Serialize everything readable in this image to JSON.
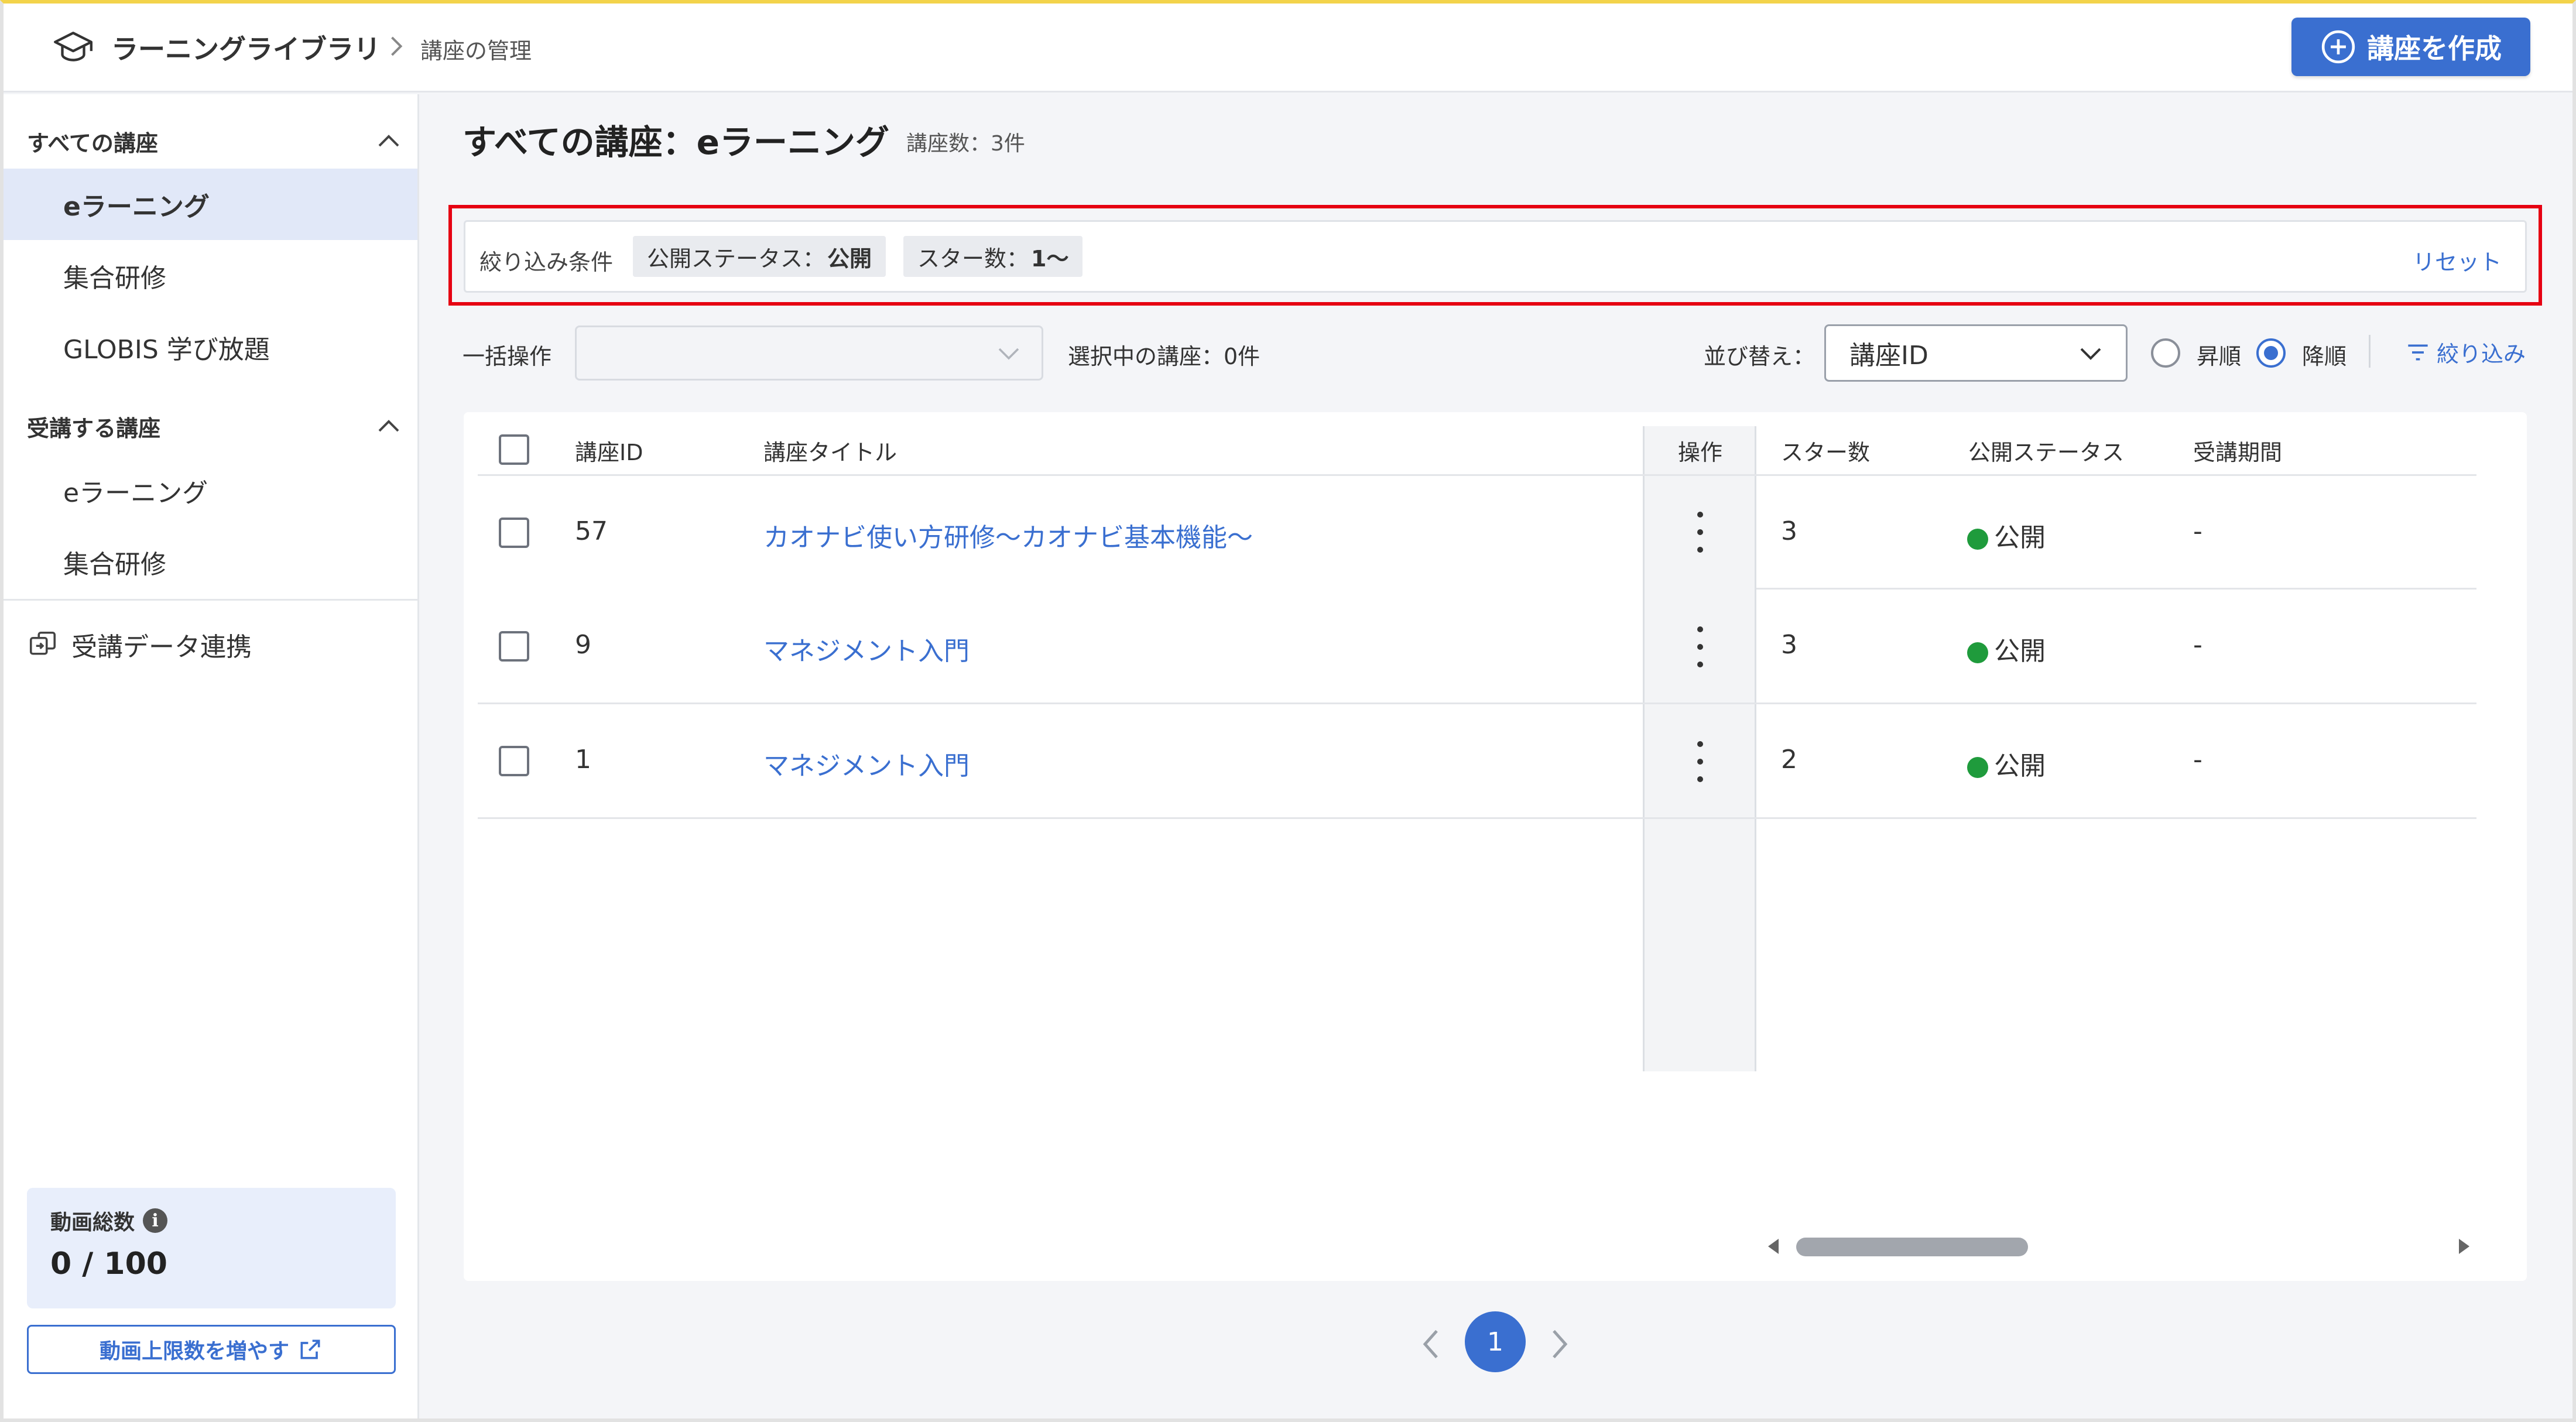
{
  "header": {
    "app_title": "ラーニングライブラリ",
    "breadcrumb": "講座の管理",
    "create_button": "講座を作成"
  },
  "sidebar": {
    "all_courses_heading": "すべての講座",
    "all_items": [
      {
        "label": "eラーニング",
        "active": true
      },
      {
        "label": "集合研修",
        "active": false
      },
      {
        "label": "GLOBIS 学び放題",
        "active": false
      }
    ],
    "enrolled_heading": "受講する講座",
    "enrolled_items": [
      {
        "label": "eラーニング"
      },
      {
        "label": "集合研修"
      }
    ],
    "sync_label": "受講データ連携",
    "quota_label": "動画総数",
    "quota_value": "0 / 100",
    "increase_button": "動画上限数を増やす"
  },
  "main": {
    "title": "すべての講座：eラーニング",
    "count": "講座数：3件",
    "filter": {
      "label": "絞り込み条件",
      "chips": [
        {
          "key": "公開ステータス：",
          "value": "公開"
        },
        {
          "key": "スター数：",
          "value": "1〜"
        }
      ],
      "reset": "リセット"
    },
    "toolbar": {
      "bulk_label": "一括操作",
      "bulk_value": "",
      "selected_count": "選択中の講座：0件",
      "sort_label": "並び替え：",
      "sort_value": "講座ID",
      "asc_label": "昇順",
      "desc_label": "降順",
      "order_selected": "desc",
      "filter_link": "絞り込み"
    },
    "table": {
      "columns": [
        "講座ID",
        "講座タイトル",
        "操作",
        "スター数",
        "公開ステータス",
        "受講期間"
      ],
      "rows": [
        {
          "id": "57",
          "title": "カオナビ使い方研修〜カオナビ基本機能〜",
          "stars": "3",
          "status": "公開",
          "period": "-"
        },
        {
          "id": "9",
          "title": "マネジメント入門",
          "stars": "3",
          "status": "公開",
          "period": "-"
        },
        {
          "id": "1",
          "title": "マネジメント入門",
          "stars": "2",
          "status": "公開",
          "period": "-"
        }
      ]
    },
    "pagination": {
      "current": "1"
    }
  },
  "colors": {
    "accent": "#3a6fd0",
    "highlight_outline": "#e60012",
    "status_published": "#1f9b3c"
  }
}
